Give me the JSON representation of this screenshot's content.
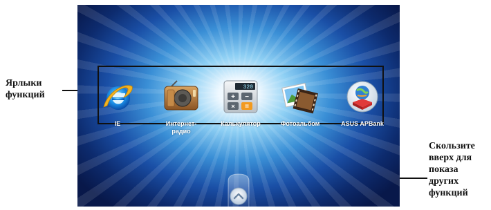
{
  "callouts": {
    "shortcuts": "Ярлыки\nфункций",
    "swipe_hint": "Скользите\nвверх для\nпоказа\nдругих\nфункций"
  },
  "apps": [
    {
      "label": "IE",
      "icon": "internet-explorer-icon"
    },
    {
      "label": "Интернет-\nрадио",
      "icon": "radio-icon"
    },
    {
      "label": "Калькулятор",
      "icon": "calculator-icon"
    },
    {
      "label": "Фотоальбом",
      "icon": "photo-album-icon"
    },
    {
      "label": "ASUS APBank",
      "icon": "asus-apbank-icon"
    }
  ],
  "calculator_display": "320",
  "colors": {
    "accent_blue": "#1a4fa6",
    "glow": "#eef8ff"
  }
}
